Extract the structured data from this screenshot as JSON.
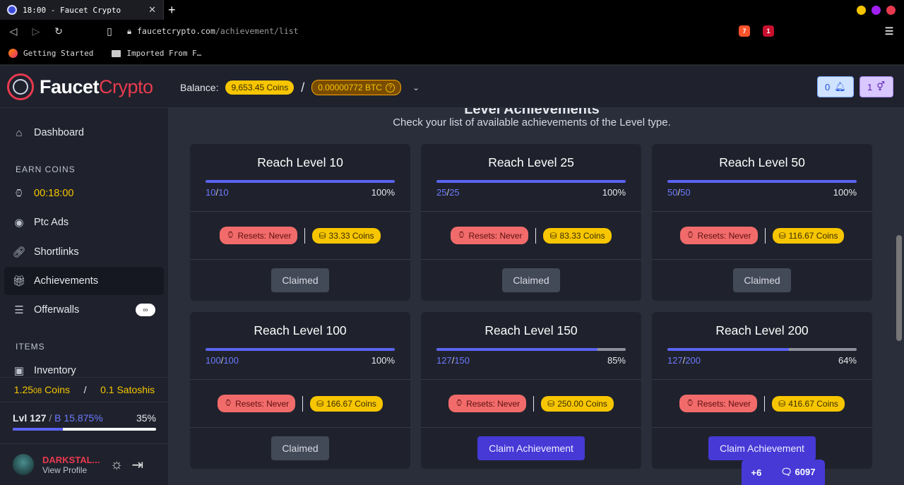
{
  "browser": {
    "tab_title": "18:00 - Faucet Crypto",
    "url_domain": "faucetcrypto.com",
    "url_path": "/achievement/list",
    "bookmarks": [
      "Getting Started",
      "Imported From F…"
    ],
    "ext_badge_1": "7",
    "ext_badge_2": "1"
  },
  "header": {
    "logo_main": "Faucet",
    "logo_accent": "Crypto",
    "balance_label": "Balance:",
    "coins": "9,653.45 Coins",
    "separator": "/",
    "btc": "0.00000772 BTC",
    "notif_count": "0",
    "gender_count": "1"
  },
  "sidebar": {
    "dashboard": "Dashboard",
    "earn_section": "EARN COINS",
    "timer": "00:18:00",
    "ptc": "Ptc Ads",
    "shortlinks": "Shortlinks",
    "achievements": "Achievements",
    "offerwalls": "Offerwalls",
    "offerwalls_badge": "∞",
    "items_section": "ITEMS",
    "inventory": "Inventory",
    "side_coins_int": "1.25",
    "side_coins_dec": "08",
    "side_coins_unit": " Coins",
    "side_sep": "/",
    "side_satoshis": "0.1 Satoshis",
    "level": "Lvl 127",
    "level_sep": " / ",
    "bonus": "B 15.875%",
    "level_pct_text": "35%",
    "level_progress": 0.35,
    "username": "DARKSTAL...",
    "view_profile": "View Profile"
  },
  "main": {
    "title": "Level Achievements",
    "subtitle": "Check your list of available achievements of the Level type.",
    "cards": [
      {
        "title": "Reach Level 10",
        "cur": "10",
        "tot": "10",
        "pct": "100%",
        "progress": 1.0,
        "resets": "Resets: Never",
        "reward": "33.33 Coins",
        "button": "Claimed",
        "state": "claimed"
      },
      {
        "title": "Reach Level 25",
        "cur": "25",
        "tot": "25",
        "pct": "100%",
        "progress": 1.0,
        "resets": "Resets: Never",
        "reward": "83.33 Coins",
        "button": "Claimed",
        "state": "claimed"
      },
      {
        "title": "Reach Level 50",
        "cur": "50",
        "tot": "50",
        "pct": "100%",
        "progress": 1.0,
        "resets": "Resets: Never",
        "reward": "116.67 Coins",
        "button": "Claimed",
        "state": "claimed"
      },
      {
        "title": "Reach Level 100",
        "cur": "100",
        "tot": "100",
        "pct": "100%",
        "progress": 1.0,
        "resets": "Resets: Never",
        "reward": "166.67 Coins",
        "button": "Claimed",
        "state": "claimed"
      },
      {
        "title": "Reach Level 150",
        "cur": "127",
        "tot": "150",
        "pct": "85%",
        "progress": 0.85,
        "resets": "Resets: Never",
        "reward": "250.00 Coins",
        "button": "Claim Achievement",
        "state": "claim"
      },
      {
        "title": "Reach Level 200",
        "cur": "127",
        "tot": "200",
        "pct": "64%",
        "progress": 0.64,
        "resets": "Resets: Never",
        "reward": "416.67 Coins",
        "button": "Claim Achievement",
        "state": "claim"
      }
    ]
  },
  "chat": {
    "plus": "+6",
    "count": "6097"
  },
  "colors": {
    "accent": "#4639d6",
    "brand_red": "#e83a4f",
    "coin_yellow": "#f7c600"
  }
}
